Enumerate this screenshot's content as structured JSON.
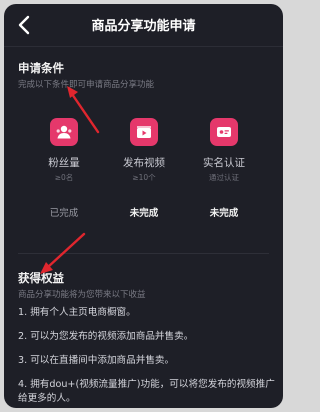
{
  "nav": {
    "title": "商品分享功能申请"
  },
  "conditions": {
    "title": "申请条件",
    "subtitle": "完成以下条件即可申请商品分享功能",
    "items": [
      {
        "label": "粉丝量",
        "requirement": "≥0名",
        "status": "已完成",
        "icon": "fans-icon"
      },
      {
        "label": "发布视频",
        "requirement": "≥10个",
        "status": "未完成",
        "icon": "video-icon"
      },
      {
        "label": "实名认证",
        "requirement": "通过认证",
        "status": "未完成",
        "icon": "id-card-icon"
      }
    ]
  },
  "benefits": {
    "title": "获得权益",
    "subtitle": "商品分享功能将为您带来以下收益",
    "items": [
      "1. 拥有个人主页电商橱窗。",
      "2. 可以为您发布的视频添加商品并售卖。",
      "3. 可以在直播间中添加商品并售卖。",
      "4. 拥有dou+(视频流量推广)功能，可以将您发布的视频推广给更多的人。"
    ]
  },
  "colors": {
    "background": "#1e1f27",
    "accent": "#e5386b",
    "annotation_arrow": "#e0262e"
  }
}
